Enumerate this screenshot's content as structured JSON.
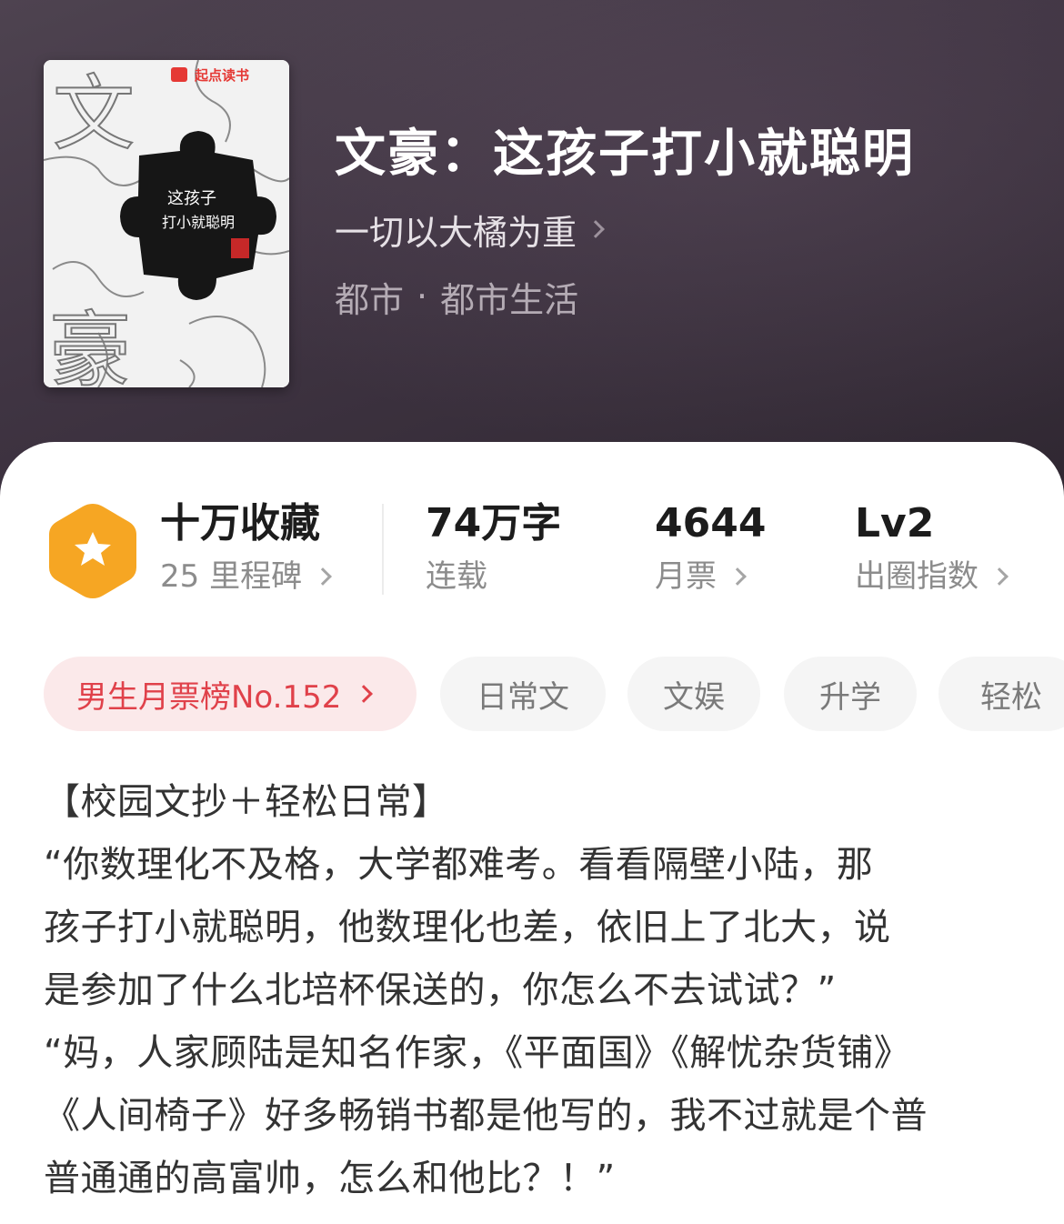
{
  "book": {
    "cover_publisher": "起点读书",
    "cover_title_line1": "这孩子",
    "cover_title_line2": "打小就聪明",
    "cover_big_chars": [
      "文",
      "豪"
    ],
    "title": "文豪：这孩子打小就聪明",
    "author": "一切以大橘为重",
    "category": "都市",
    "subcategory": "都市生活",
    "genre_separator": "·"
  },
  "stats": [
    {
      "value": "十万收藏",
      "label": "25 里程碑",
      "has_arrow": true
    },
    {
      "value": "74万字",
      "label": "连载",
      "has_arrow": false
    },
    {
      "value": "4644",
      "label": "月票",
      "has_arrow": true
    },
    {
      "value": "Lv2",
      "label": "出圈指数",
      "has_arrow": true
    }
  ],
  "tags": {
    "rank": "男生月票榜No.152",
    "items": [
      "日常文",
      "文娱",
      "升学",
      "轻松"
    ]
  },
  "description": [
    "【校园文抄＋轻松日常】",
    "“你数理化不及格，大学都难考。看看隔壁小陆，那",
    "孩子打小就聪明，他数理化也差，依旧上了北大，说",
    "是参加了什么北培杯保送的，你怎么不去试试？”",
    "“妈，人家顾陆是知名作家，《平面国》《解忧杂货铺》",
    "《人间椅子》好多畅销书都是他写的，我不过就是个普",
    "普通通的高富帅，怎么和他比？！”"
  ],
  "colors": {
    "header_bg": "#3f3442",
    "accent_red": "#e0414a",
    "rank_tag_bg": "#fbe9ea",
    "badge_orange": "#f6a623",
    "tag_bg": "#f5f5f5"
  },
  "icons": {
    "badge": "star-hexagon-icon",
    "arrow": "chevron-right-icon"
  }
}
